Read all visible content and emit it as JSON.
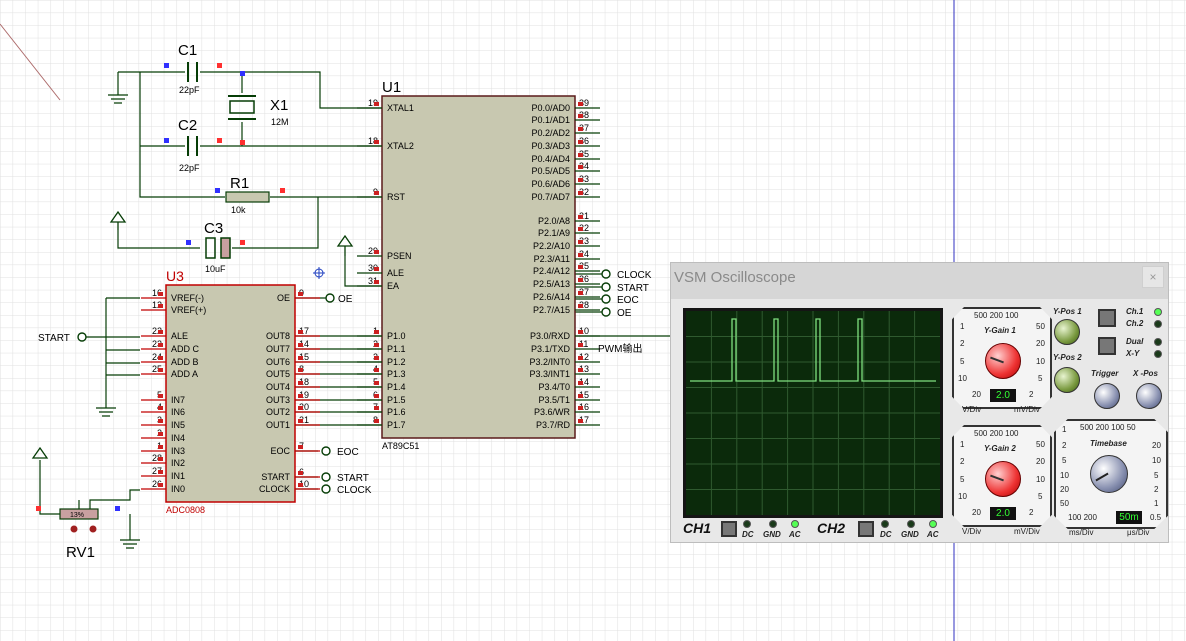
{
  "components": {
    "c1": {
      "ref": "C1",
      "value": "22pF"
    },
    "c2": {
      "ref": "C2",
      "value": "22pF"
    },
    "c3": {
      "ref": "C3",
      "value": "10uF"
    },
    "x1": {
      "ref": "X1",
      "value": "12M"
    },
    "r1": {
      "ref": "R1",
      "value": "10k"
    },
    "rv1": {
      "ref": "RV1",
      "value": "13%"
    },
    "u1": {
      "ref": "U1",
      "part": "AT89C51"
    },
    "u3": {
      "ref": "U3",
      "part": "ADC0808"
    }
  },
  "u1_left_pins": [
    {
      "num": "19",
      "name": "XTAL1"
    },
    {
      "num": "18",
      "name": "XTAL2"
    },
    {
      "num": "9",
      "name": "RST"
    },
    {
      "num": "29",
      "name": "PSEN"
    },
    {
      "num": "30",
      "name": "ALE"
    },
    {
      "num": "31",
      "name": "EA"
    },
    {
      "num": "1",
      "name": "P1.0"
    },
    {
      "num": "2",
      "name": "P1.1"
    },
    {
      "num": "3",
      "name": "P1.2"
    },
    {
      "num": "4",
      "name": "P1.3"
    },
    {
      "num": "5",
      "name": "P1.4"
    },
    {
      "num": "6",
      "name": "P1.5"
    },
    {
      "num": "7",
      "name": "P1.6"
    },
    {
      "num": "8",
      "name": "P1.7"
    }
  ],
  "u1_right_pins": [
    {
      "num": "39",
      "name": "P0.0/AD0"
    },
    {
      "num": "38",
      "name": "P0.1/AD1"
    },
    {
      "num": "37",
      "name": "P0.2/AD2"
    },
    {
      "num": "36",
      "name": "P0.3/AD3"
    },
    {
      "num": "35",
      "name": "P0.4/AD4"
    },
    {
      "num": "34",
      "name": "P0.5/AD5"
    },
    {
      "num": "33",
      "name": "P0.6/AD6"
    },
    {
      "num": "32",
      "name": "P0.7/AD7"
    },
    {
      "num": "21",
      "name": "P2.0/A8"
    },
    {
      "num": "22",
      "name": "P2.1/A9"
    },
    {
      "num": "23",
      "name": "P2.2/A10"
    },
    {
      "num": "24",
      "name": "P2.3/A11"
    },
    {
      "num": "25",
      "name": "P2.4/A12"
    },
    {
      "num": "26",
      "name": "P2.5/A13"
    },
    {
      "num": "27",
      "name": "P2.6/A14"
    },
    {
      "num": "28",
      "name": "P2.7/A15"
    },
    {
      "num": "10",
      "name": "P3.0/RXD"
    },
    {
      "num": "11",
      "name": "P3.1/TXD"
    },
    {
      "num": "12",
      "name": "P3.2/INT0"
    },
    {
      "num": "13",
      "name": "P3.3/INT1"
    },
    {
      "num": "14",
      "name": "P3.4/T0"
    },
    {
      "num": "15",
      "name": "P3.5/T1"
    },
    {
      "num": "16",
      "name": "P3.6/WR"
    },
    {
      "num": "17",
      "name": "P3.7/RD"
    }
  ],
  "u3_left_pins": [
    {
      "num": "16",
      "name": "VREF(-)"
    },
    {
      "num": "12",
      "name": "VREF(+)"
    },
    {
      "num": "22",
      "name": "ALE"
    },
    {
      "num": "23",
      "name": "ADD C"
    },
    {
      "num": "24",
      "name": "ADD B"
    },
    {
      "num": "25",
      "name": "ADD A"
    },
    {
      "num": "5",
      "name": "IN7"
    },
    {
      "num": "4",
      "name": "IN6"
    },
    {
      "num": "3",
      "name": "IN5"
    },
    {
      "num": "2",
      "name": "IN4"
    },
    {
      "num": "1",
      "name": "IN3"
    },
    {
      "num": "28",
      "name": "IN2"
    },
    {
      "num": "27",
      "name": "IN1"
    },
    {
      "num": "26",
      "name": "IN0"
    }
  ],
  "u3_right_pins": [
    {
      "num": "9",
      "name": "OE"
    },
    {
      "num": "17",
      "name": "OUT8"
    },
    {
      "num": "14",
      "name": "OUT7"
    },
    {
      "num": "15",
      "name": "OUT6"
    },
    {
      "num": "8",
      "name": "OUT5"
    },
    {
      "num": "18",
      "name": "OUT4"
    },
    {
      "num": "19",
      "name": "OUT3"
    },
    {
      "num": "20",
      "name": "OUT2"
    },
    {
      "num": "21",
      "name": "OUT1"
    },
    {
      "num": "7",
      "name": "EOC"
    },
    {
      "num": "6",
      "name": "START"
    },
    {
      "num": "10",
      "name": "CLOCK"
    }
  ],
  "net_labels": {
    "u1_clock": "CLOCK",
    "u1_start": "START",
    "u1_eoc": "EOC",
    "u1_oe": "OE",
    "u3_oe": "OE",
    "u3_eoc": "EOC",
    "u3_start": "START",
    "u3_clock": "CLOCK",
    "left_start": "START",
    "pwm": "PWM输出"
  },
  "oscilloscope": {
    "title": "VSM Oscilloscope",
    "close": "×",
    "ygain1": {
      "label": "Y-Gain 1",
      "scale_top": "500 200 100",
      "left": [
        "1",
        "2",
        "5",
        "10",
        "20"
      ],
      "right": [
        "50",
        "20",
        "10",
        "5",
        "2"
      ],
      "value": "2.0",
      "unit_left": "V/Div",
      "unit_right": "mV/Div"
    },
    "ygain2": {
      "label": "Y-Gain 2",
      "scale_top": "500 200 100",
      "left": [
        "1",
        "2",
        "5",
        "10",
        "20"
      ],
      "right": [
        "50",
        "20",
        "10",
        "5",
        "2"
      ],
      "value": "2.0",
      "unit_left": "V/Div",
      "unit_right": "mV/Div"
    },
    "timebase": {
      "label": "Timebase",
      "scale_top": "500 200 100 50",
      "scale_bottom": "100 200",
      "left": [
        "1",
        "2",
        "5",
        "10",
        "20",
        "50"
      ],
      "right": [
        "20",
        "10",
        "5",
        "2",
        "1",
        "0.5"
      ],
      "value": "50m",
      "unit_left": "ms/Div",
      "unit_right": "μs/Div"
    },
    "ypos1": "Y-Pos 1",
    "ypos2": "Y-Pos 2",
    "trigger": "Trigger",
    "xpos": "X -Pos",
    "ch1_label": "Ch.1",
    "ch2_label": "Ch.2",
    "dual_label": "Dual",
    "xy_label": "X-Y",
    "bottom": {
      "ch1": "CH1",
      "ch2": "CH2",
      "dc": "DC",
      "gnd": "GND",
      "ac": "AC"
    },
    "trace_color": "#7fe07f",
    "grid_color": "#2f5a2f"
  },
  "colors": {
    "component_red": "#c00000",
    "body_fill": "#c8c8b0",
    "wire": "#003300",
    "grid": "#e0e0e0"
  }
}
